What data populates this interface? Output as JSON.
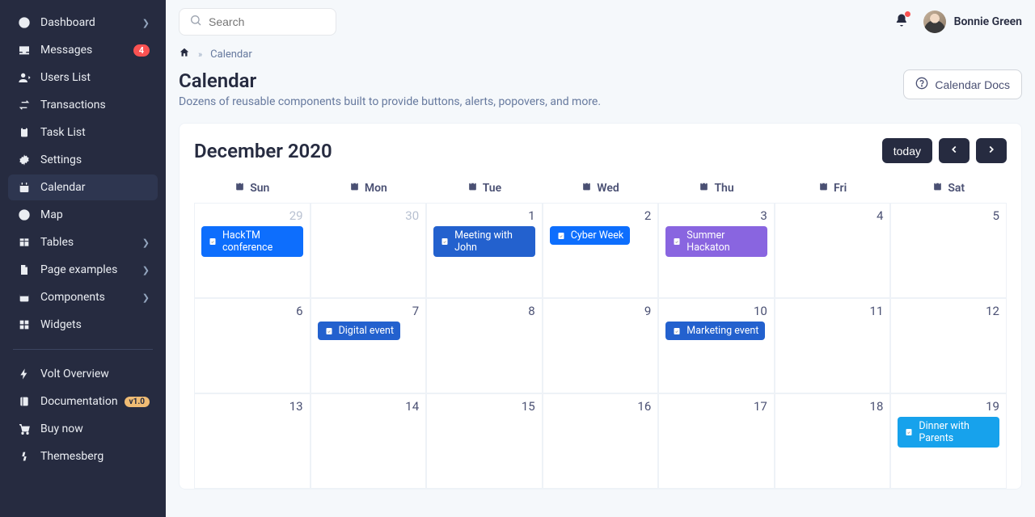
{
  "sidebar": {
    "items": [
      {
        "label": "Dashboard",
        "icon": "pie",
        "chevron": true
      },
      {
        "label": "Messages",
        "icon": "inbox",
        "badge": "4"
      },
      {
        "label": "Users List",
        "icon": "user"
      },
      {
        "label": "Transactions",
        "icon": "swap"
      },
      {
        "label": "Task List",
        "icon": "clipboard"
      },
      {
        "label": "Settings",
        "icon": "gear"
      },
      {
        "label": "Calendar",
        "icon": "calendar",
        "active": true
      },
      {
        "label": "Map",
        "icon": "globe"
      },
      {
        "label": "Tables",
        "icon": "table",
        "chevron": true
      },
      {
        "label": "Page examples",
        "icon": "page",
        "chevron": true
      },
      {
        "label": "Components",
        "icon": "box",
        "chevron": true
      },
      {
        "label": "Widgets",
        "icon": "grid"
      }
    ],
    "bottom": [
      {
        "label": "Volt Overview",
        "icon": "bolt"
      },
      {
        "label": "Documentation",
        "icon": "book",
        "pill": "v1.0"
      },
      {
        "label": "Buy now",
        "icon": "cart"
      },
      {
        "label": "Themesberg",
        "icon": "logo"
      }
    ]
  },
  "search": {
    "placeholder": "Search"
  },
  "user": {
    "name": "Bonnie Green"
  },
  "breadcrumb": {
    "current": "Calendar"
  },
  "page": {
    "title": "Calendar",
    "subtitle": "Dozens of reusable components built to provide buttons, alerts, popovers, and more.",
    "docs_button": "Calendar Docs"
  },
  "calendar": {
    "title": "December 2020",
    "today_label": "today",
    "day_headers": [
      "Sun",
      "Mon",
      "Tue",
      "Wed",
      "Thu",
      "Fri",
      "Sat"
    ],
    "cells": [
      {
        "num": "29",
        "dim": true,
        "events": [
          {
            "title": "HackTM conference",
            "color": "primary"
          }
        ]
      },
      {
        "num": "30",
        "dim": true
      },
      {
        "num": "1",
        "events": [
          {
            "title": "Meeting with John",
            "color": "secondary"
          }
        ]
      },
      {
        "num": "2",
        "events": [
          {
            "title": "Cyber Week",
            "color": "primary"
          }
        ]
      },
      {
        "num": "3",
        "events": [
          {
            "title": "Summer Hackaton",
            "color": "purple"
          }
        ]
      },
      {
        "num": "4"
      },
      {
        "num": "5"
      },
      {
        "num": "6"
      },
      {
        "num": "7",
        "events": [
          {
            "title": "Digital event",
            "color": "secondary"
          }
        ]
      },
      {
        "num": "8"
      },
      {
        "num": "9"
      },
      {
        "num": "10",
        "events": [
          {
            "title": "Marketing event",
            "color": "secondary"
          }
        ]
      },
      {
        "num": "11"
      },
      {
        "num": "12"
      },
      {
        "num": "13"
      },
      {
        "num": "14"
      },
      {
        "num": "15"
      },
      {
        "num": "16"
      },
      {
        "num": "17"
      },
      {
        "num": "18"
      },
      {
        "num": "19",
        "events": [
          {
            "title": "Dinner with Parents",
            "color": "info"
          }
        ]
      }
    ]
  }
}
